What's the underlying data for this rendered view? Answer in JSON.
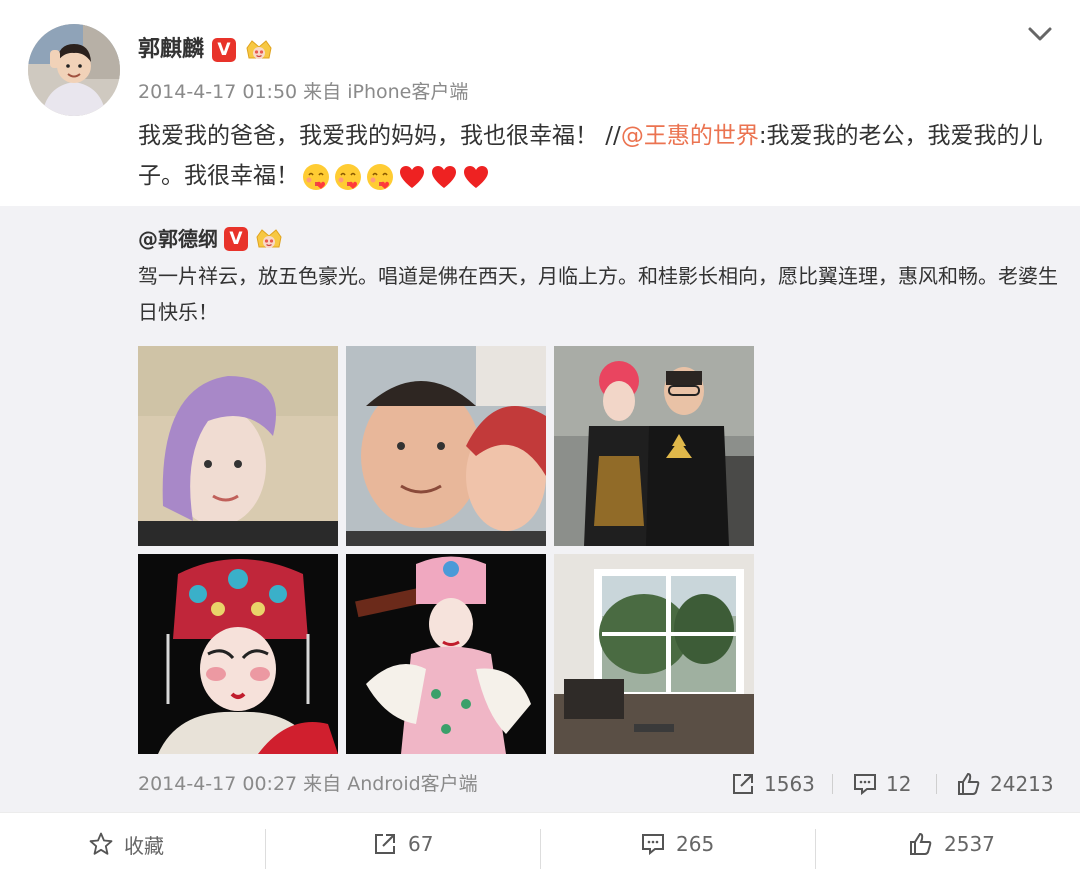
{
  "post": {
    "author": "郭麒麟",
    "verified_badge": "V",
    "meta": "2014-4-17 01:50 来自 iPhone客户端",
    "text_before": "我爱我的爸爸，我爱我的妈妈，我也很幸福！ //",
    "mention": "@王惠的世界",
    "text_after": ":我爱我的老公，我爱我的儿子。我很幸福！",
    "emojis": [
      "kiss-face-icon",
      "kiss-face-icon",
      "kiss-face-icon",
      "heart-icon",
      "heart-icon",
      "heart-icon"
    ]
  },
  "repost": {
    "author": "@郭德纲",
    "verified_badge": "V",
    "text": "驾一片祥云，放五色豪光。唱道是佛在西天，月临上方。和桂影长相向，愿比翼连理，惠风和畅。老婆生日快乐！",
    "meta": "2014-4-17 00:27 来自 Android客户端",
    "shares": "1563",
    "comments": "12",
    "likes": "24213"
  },
  "actions": {
    "favorite": "收藏",
    "shares": "67",
    "comments": "265",
    "likes": "2537"
  },
  "colors": {
    "mention": "#eb7350",
    "verified": "#e8332a",
    "repost_bg": "#f2f2f5"
  }
}
